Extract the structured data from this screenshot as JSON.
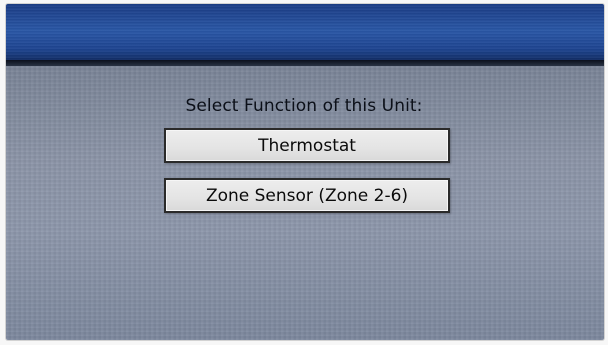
{
  "screen": {
    "prompt": "Select Function of this Unit:"
  },
  "options": [
    {
      "label": "Thermostat"
    },
    {
      "label": "Zone Sensor (Zone 2-6)"
    }
  ],
  "colors": {
    "title_bar": "#1f468f",
    "background": "#8a93a6",
    "button_face": "#e6e6e6",
    "button_border": "#2a2a2a",
    "text": "#0b0f18"
  }
}
